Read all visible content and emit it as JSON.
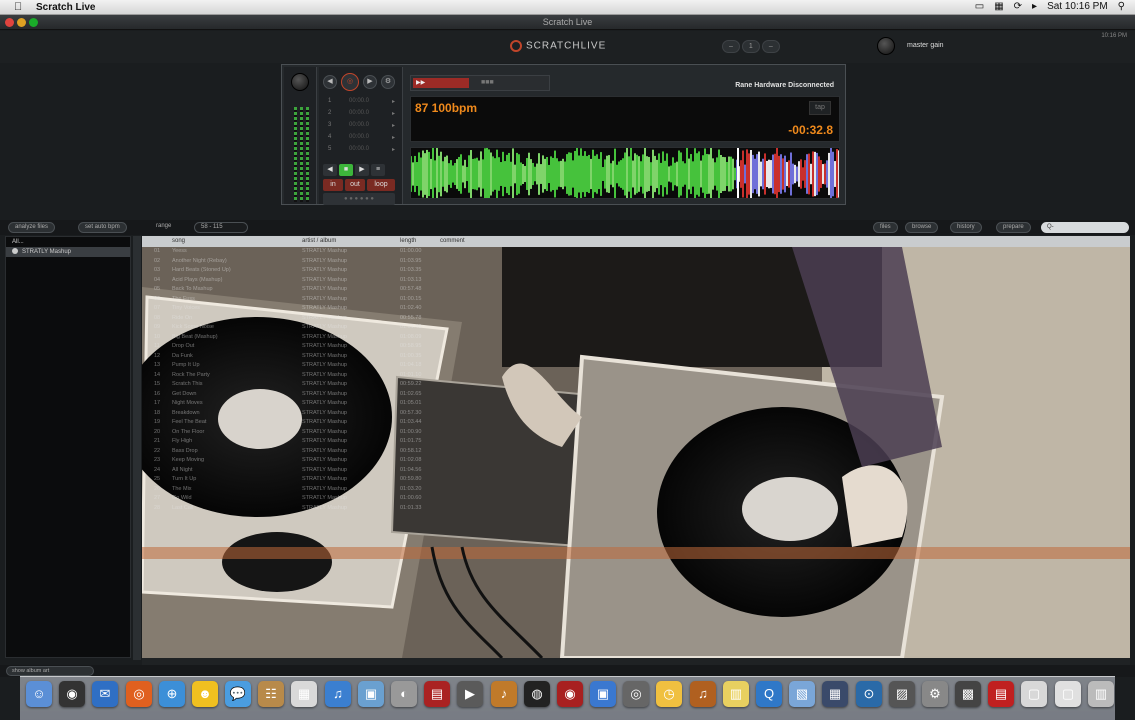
{
  "menubar": {
    "apple": "",
    "app_name": "Scratch Live",
    "clock": "Sat 10:16 PM"
  },
  "window": {
    "title": "Scratch Live"
  },
  "header": {
    "logo_text": "SCRATCHLIVE",
    "master_gain_label": "master gain",
    "clock_small": "10:16 PM"
  },
  "deck": {
    "bpm_text": "87 100bpm",
    "tap_label": "tap",
    "remaining_time": "-00:32.8",
    "hardware_status": "Rane Hardware Disconnected",
    "ctrl_buttons": [
      "in",
      "out",
      "loop"
    ]
  },
  "library_toolbar": {
    "analyze_label": "analyze files",
    "autoload_label": "set auto bpm",
    "range_label": "range",
    "range_value": "58 - 115",
    "right_buttons": [
      "files",
      "browse",
      "history",
      "prepare"
    ],
    "search_value": "Q-"
  },
  "sidebar": {
    "items": [
      {
        "label": "All..."
      },
      {
        "label": "STRATLY Mashup"
      }
    ]
  },
  "track_columns": [
    "song",
    "artist / album",
    "length",
    "comment"
  ],
  "tracks": [
    {
      "num": "01",
      "song": "Yeess",
      "album": "STRATLY Mashup",
      "len": "01:00.00"
    },
    {
      "num": "02",
      "song": "Another Night (Rebay)",
      "album": "STRATLY Mashup",
      "len": "01:03.95"
    },
    {
      "num": "03",
      "song": "Hard Beats (Stoned Up)",
      "album": "STRATLY Mashup",
      "len": "01:03.35"
    },
    {
      "num": "04",
      "song": "Acid Plays (Mashup)",
      "album": "STRATLY Mashup",
      "len": "01:03.13"
    },
    {
      "num": "05",
      "song": "Back To Mashup",
      "album": "STRATLY Mashup",
      "len": "00:57.48"
    },
    {
      "num": "06",
      "song": "The Fuss",
      "album": "STRATLY Mashup",
      "len": "01:00.15"
    },
    {
      "num": "07",
      "song": "Tiny Voices",
      "album": "STRATLY Mashup",
      "len": "01:02.40"
    },
    {
      "num": "08",
      "song": "Ride On",
      "album": "STRATLY Mashup",
      "len": "00:55.78"
    },
    {
      "num": "09",
      "song": "Kick Some Noise",
      "album": "STRATLY Mashup",
      "len": "01:01.48"
    },
    {
      "num": "10",
      "song": "Big Beat (Mashup)",
      "album": "STRATLY Mashup",
      "len": "01:08.09"
    },
    {
      "num": "11",
      "song": "Drop Out",
      "album": "STRATLY Mashup",
      "len": "00:58.95"
    },
    {
      "num": "12",
      "song": "Da Funk",
      "album": "STRATLY Mashup",
      "len": "01:00.35"
    },
    {
      "num": "13",
      "song": "Pump It Up",
      "album": "STRATLY Mashup",
      "len": "01:04.18"
    },
    {
      "num": "14",
      "song": "Rock The Party",
      "album": "STRATLY Mashup",
      "len": "01:01.10"
    },
    {
      "num": "15",
      "song": "Scratch This",
      "album": "STRATLY Mashup",
      "len": "00:59.22"
    },
    {
      "num": "16",
      "song": "Get Down",
      "album": "STRATLY Mashup",
      "len": "01:02.65"
    },
    {
      "num": "17",
      "song": "Night Moves",
      "album": "STRATLY Mashup",
      "len": "01:05.01"
    },
    {
      "num": "18",
      "song": "Breakdown",
      "album": "STRATLY Mashup",
      "len": "00:57.30"
    },
    {
      "num": "19",
      "song": "Feel The Beat",
      "album": "STRATLY Mashup",
      "len": "01:03.44"
    },
    {
      "num": "20",
      "song": "On The Floor",
      "album": "STRATLY Mashup",
      "len": "01:00.90"
    },
    {
      "num": "21",
      "song": "Fly High",
      "album": "STRATLY Mashup",
      "len": "01:01.75"
    },
    {
      "num": "22",
      "song": "Bass Drop",
      "album": "STRATLY Mashup",
      "len": "00:58.12"
    },
    {
      "num": "23",
      "song": "Keep Moving",
      "album": "STRATLY Mashup",
      "len": "01:02.08"
    },
    {
      "num": "24",
      "song": "All Night",
      "album": "STRATLY Mashup",
      "len": "01:04.56"
    },
    {
      "num": "25",
      "song": "Turn It Up",
      "album": "STRATLY Mashup",
      "len": "00:59.80"
    },
    {
      "num": "26",
      "song": "The Mix",
      "album": "STRATLY Mashup",
      "len": "01:03.20"
    },
    {
      "num": "27",
      "song": "Go Wild",
      "album": "STRATLY Mashup",
      "len": "01:00.60"
    },
    {
      "num": "28",
      "song": "Last Call",
      "album": "STRATLY Mashup",
      "len": "01:01.33"
    }
  ],
  "status": {
    "view_dropdown": "show album art"
  },
  "colors": {
    "accent_orange": "#f08a1c",
    "waveform_green": "#46c23c",
    "deck_red": "#9c2b26"
  },
  "dock": {
    "icons": [
      "finder-icon",
      "dashboard-icon",
      "mail-icon",
      "firefox-icon",
      "safari-icon",
      "ichat-smiley-icon",
      "ichat-icon",
      "address-book-icon",
      "ical-icon",
      "itunes-icon",
      "iphoto-icon",
      "facetime-icon",
      "photo-booth-icon",
      "imovie-icon",
      "garageband-icon",
      "dvd-icon",
      "scratch-icon",
      "itunes-store-icon",
      "compass-icon",
      "clock-icon",
      "guitar-icon",
      "stickies-icon",
      "quicktime-icon",
      "preview-icon",
      "spaces-icon",
      "time-machine-icon",
      "activity-monitor-icon",
      "system-prefs-icon",
      "app-icon",
      "video-icon",
      "documents-icon",
      "downloads-icon",
      "trash-icon"
    ]
  }
}
